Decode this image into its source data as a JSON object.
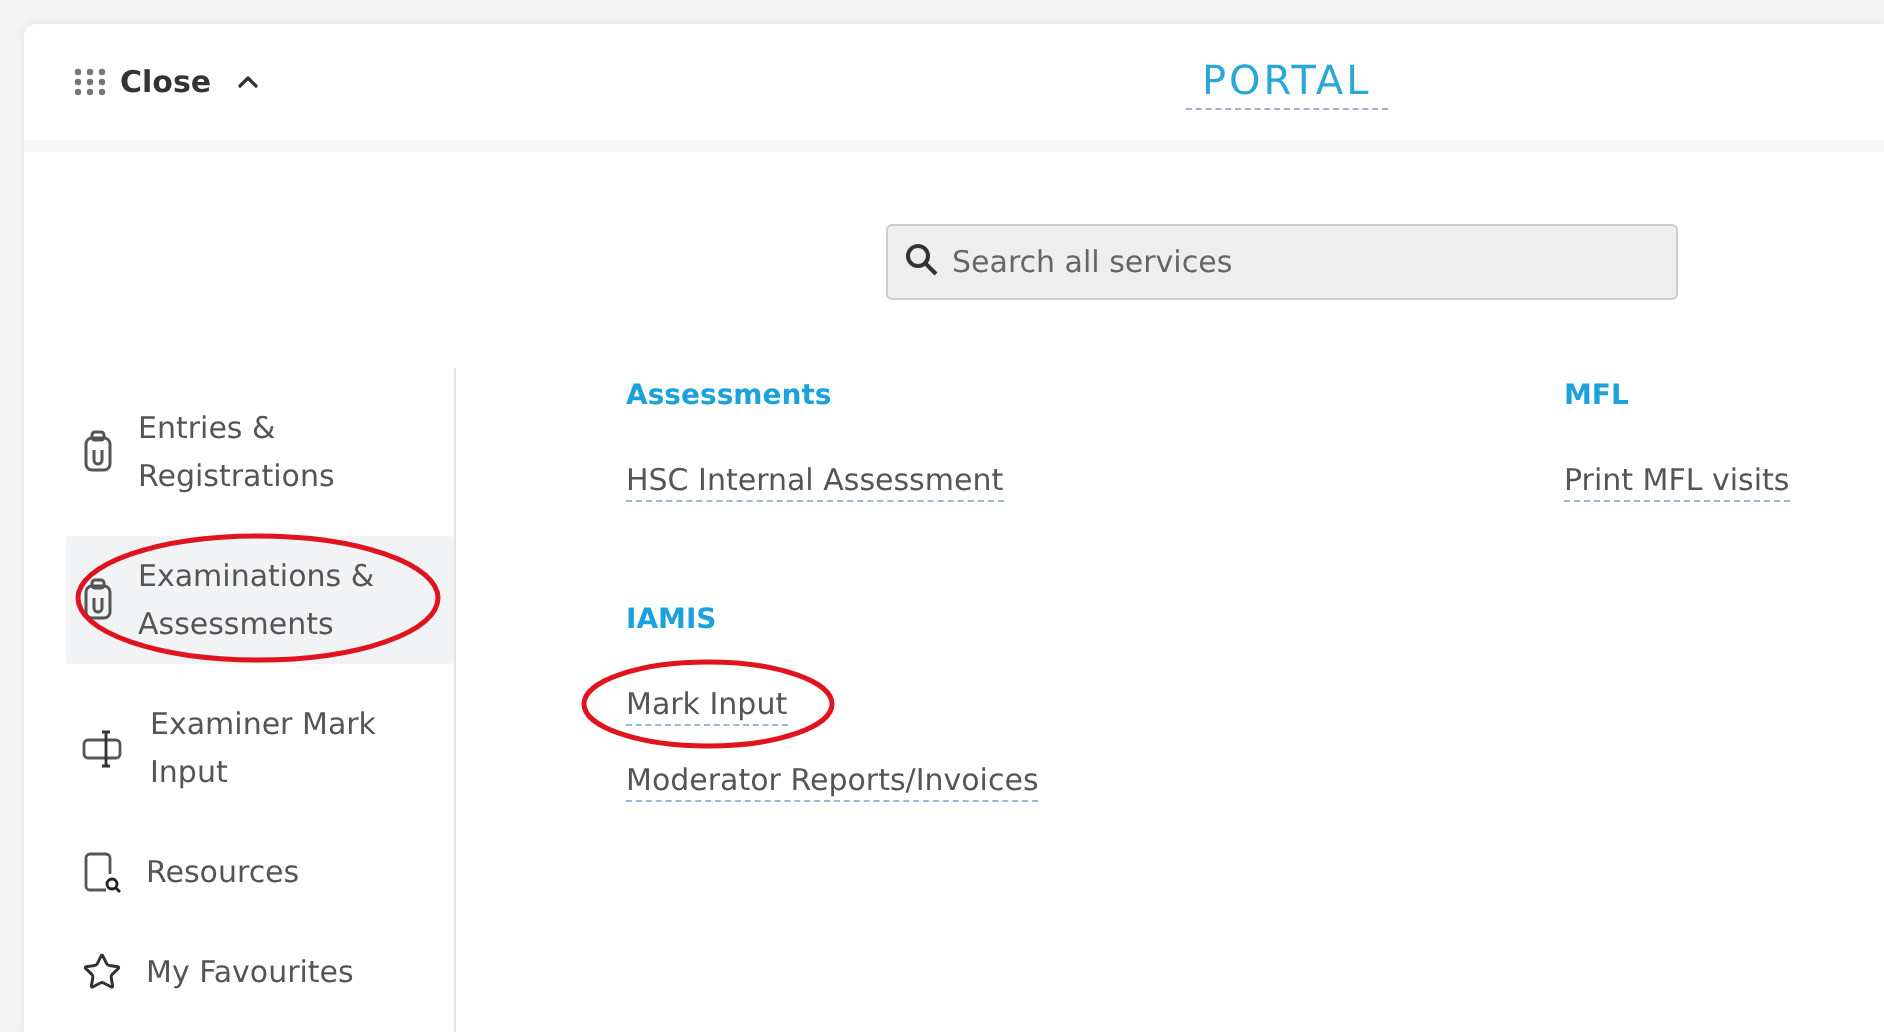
{
  "header": {
    "close_label": "Close",
    "title": "PORTAL"
  },
  "search": {
    "placeholder": "Search all services"
  },
  "sidebar": {
    "items": [
      {
        "kind": "clipboard",
        "label": "Entries & Registrations",
        "selected": false,
        "circled": false
      },
      {
        "kind": "clipboard",
        "label": "Examinations & Assessments",
        "selected": true,
        "circled": true
      },
      {
        "kind": "input",
        "label": "Examiner Mark Input",
        "selected": false,
        "circled": false
      },
      {
        "kind": "resources",
        "label": "Resources",
        "selected": false,
        "circled": false
      },
      {
        "kind": "star",
        "label": "My Favourites",
        "selected": false,
        "circled": false
      }
    ]
  },
  "columns": [
    [
      {
        "title": "Assessments",
        "links": [
          {
            "label": "HSC Internal Assessment",
            "circled": false
          }
        ]
      },
      {
        "title": "IAMIS",
        "links": [
          {
            "label": "Mark Input",
            "circled": true
          },
          {
            "label": "Moderator Reports/Invoices",
            "circled": false
          }
        ]
      }
    ],
    [
      {
        "title": "MFL",
        "links": [
          {
            "label": "Print MFL visits",
            "circled": false
          }
        ]
      }
    ]
  ]
}
